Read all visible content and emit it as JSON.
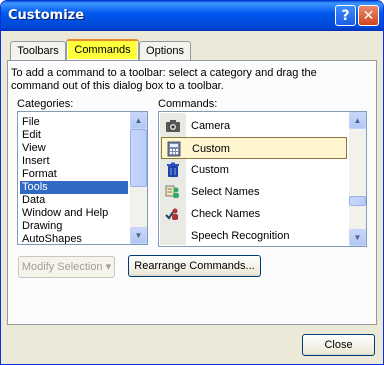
{
  "title": "Customize",
  "title_buttons": {
    "help": "?",
    "close": "✕"
  },
  "tabs": [
    {
      "label": "Toolbars"
    },
    {
      "label": "Commands"
    },
    {
      "label": "Options"
    }
  ],
  "description": "To add a command to a toolbar: select a category and drag the command out of this dialog box to a toolbar.",
  "categories_label": "Categories:",
  "commands_label": "Commands:",
  "categories": [
    "File",
    "Edit",
    "View",
    "Insert",
    "Format",
    "Tools",
    "Data",
    "Window and Help",
    "Drawing",
    "AutoShapes"
  ],
  "selected_category": "Tools",
  "commands": [
    {
      "label": "Camera",
      "icon": "camera-icon"
    },
    {
      "label": "Custom",
      "icon": "calculator-icon"
    },
    {
      "label": "Custom",
      "icon": "trash-can-icon"
    },
    {
      "label": "Select Names",
      "icon": "select-names-icon"
    },
    {
      "label": "Check Names",
      "icon": "check-names-icon"
    },
    {
      "label": "Speech Recognition",
      "icon": "speech-icon"
    }
  ],
  "selected_command_index": 1,
  "buttons": {
    "modify_selection": "Modify Selection ▾",
    "rearrange_commands": "Rearrange Commands...",
    "close": "Close"
  },
  "colors": {
    "title_bar": "#0058ee",
    "selection": "#316ac5",
    "tab_highlight": "#ffff3c"
  }
}
